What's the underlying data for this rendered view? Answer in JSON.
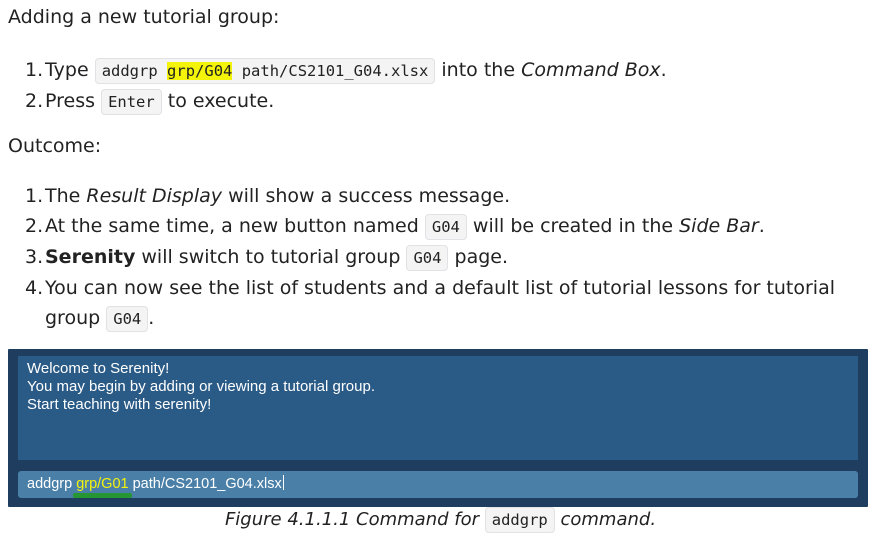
{
  "intro_heading": "Adding a new tutorial group:",
  "steps": [
    {
      "num": "1.",
      "pre": "Type",
      "code_a": "addgrp",
      "code_hl": "grp/G04",
      "code_b": "path/CS2101_G04.xlsx",
      "mid": "into the",
      "em": "Command Box",
      "post": "."
    },
    {
      "num": "2.",
      "pre": "Press",
      "code": "Enter",
      "post": "to execute."
    }
  ],
  "outcome_heading": "Outcome:",
  "outcomes": [
    {
      "num": "1.",
      "pre": "The",
      "em": "Result Display",
      "post": "will show a success message."
    },
    {
      "num": "2.",
      "pre": "At the same time, a new button named",
      "code": "G04",
      "mid": "will be created in the",
      "em": "Side Bar",
      "post": "."
    },
    {
      "num": "3.",
      "strong": "Serenity",
      "pre": "will switch to tutorial group",
      "code": "G04",
      "post": "page."
    },
    {
      "num": "4.",
      "pre": "You can now see the list of students and a default list of tutorial lessons for tutorial group",
      "code": "G04",
      "post": "."
    }
  ],
  "app": {
    "result_lines": [
      "Welcome to Serenity!",
      "You may begin by adding or viewing a tutorial group.",
      "Start teaching with serenity!"
    ],
    "command": {
      "pre": "addgrp ",
      "highlight": "grp/G01",
      "post": " path/CS2101_G04.xlsx"
    },
    "colors": {
      "window_bg": "#1f3d5e",
      "result_bg": "#2a5a86",
      "command_bg": "#4a7fa8",
      "highlight": "#f4f40a",
      "underline": "#1f9a1f"
    }
  },
  "caption": {
    "pre": "Figure 4.1.1.1 Command for",
    "code": "addgrp",
    "post": "command."
  }
}
